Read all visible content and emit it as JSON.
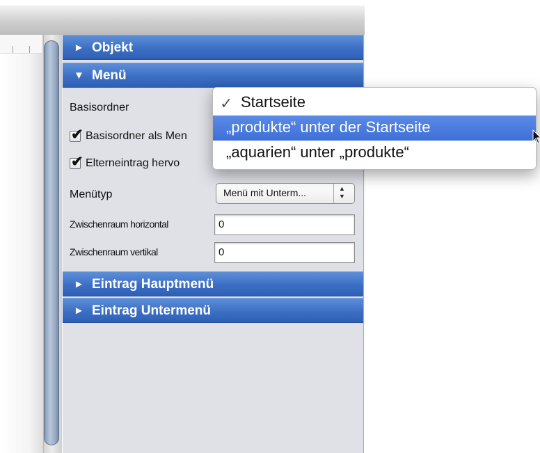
{
  "inspector": {
    "sections": {
      "objekt": {
        "label": "Objekt",
        "expanded": false
      },
      "menu": {
        "label": "Menü",
        "expanded": true
      },
      "eintrag_hauptmenu": {
        "label": "Eintrag Hauptmenü",
        "expanded": false
      },
      "eintrag_untermenu": {
        "label": "Eintrag Untermenü",
        "expanded": false
      }
    },
    "menu_panel": {
      "basisordner_label": "Basisordner",
      "basisordner_als_menu_label": "Basisordner als Men",
      "basisordner_als_menu_checked": true,
      "elterneintrag_label": "Elterneintrag hervo",
      "elterneintrag_checked": true,
      "menutyp_label": "Menütyp",
      "menutyp_value": "Menü mit Unterm...",
      "zwischenraum_horizontal_label": "Zwischenraum horizontal",
      "zwischenraum_horizontal_value": "0",
      "zwischenraum_vertikal_label": "Zwischenraum vertikal",
      "zwischenraum_vertikal_value": "0"
    }
  },
  "basisordner_dropdown": {
    "items": [
      {
        "label": "Startseite",
        "checked": true,
        "highlighted": false
      },
      {
        "label": "„produkte“ unter der Startseite",
        "checked": false,
        "highlighted": true
      },
      {
        "label": "„aquarien“ unter „produkte“",
        "checked": false,
        "highlighted": false
      }
    ]
  },
  "glyphs": {
    "expanded": "▼",
    "collapsed": "►",
    "check": "✓",
    "checkbox_check": "✔",
    "popup_arrows_up": "▲",
    "popup_arrows_down": "▼"
  },
  "colors": {
    "section_header": "#3c6fc4",
    "menu_highlight": "#3e6fd7",
    "panel_background": "#dfe1e7"
  }
}
